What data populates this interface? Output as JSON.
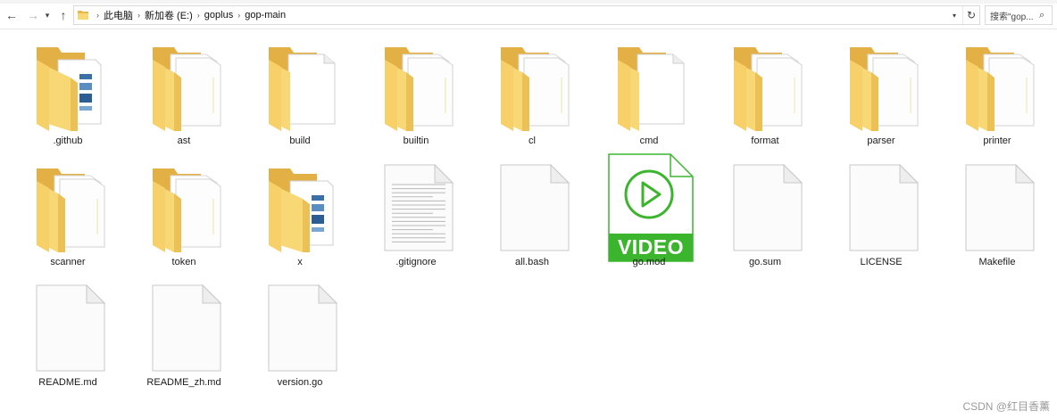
{
  "navigation": {
    "back_icon": "←",
    "forward_icon": "→",
    "recent_icon": "▾",
    "up_icon": "↑"
  },
  "address": {
    "crumbs": [
      "此电脑",
      "新加卷 (E:)",
      "goplus",
      "gop-main"
    ],
    "separator": "›",
    "dropdown_icon": "▾",
    "refresh_icon": "↻"
  },
  "search": {
    "placeholder": "搜索\"gop...",
    "icon": "⌕"
  },
  "items": [
    {
      "name": ".github",
      "kind": "folder-media"
    },
    {
      "name": "ast",
      "kind": "folder-docs"
    },
    {
      "name": "build",
      "kind": "folder-single"
    },
    {
      "name": "builtin",
      "kind": "folder-docs"
    },
    {
      "name": "cl",
      "kind": "folder-docs"
    },
    {
      "name": "cmd",
      "kind": "folder-single"
    },
    {
      "name": "format",
      "kind": "folder-docs"
    },
    {
      "name": "parser",
      "kind": "folder-docs"
    },
    {
      "name": "printer",
      "kind": "folder-docs"
    },
    {
      "name": "scanner",
      "kind": "folder-docs"
    },
    {
      "name": "token",
      "kind": "folder-docs"
    },
    {
      "name": "x",
      "kind": "folder-media"
    },
    {
      "name": ".gitignore",
      "kind": "text-file"
    },
    {
      "name": "all.bash",
      "kind": "blank-file"
    },
    {
      "name": "go.mod",
      "kind": "video-file"
    },
    {
      "name": "go.sum",
      "kind": "blank-file"
    },
    {
      "name": "LICENSE",
      "kind": "blank-file"
    },
    {
      "name": "Makefile",
      "kind": "blank-file"
    },
    {
      "name": "README.md",
      "kind": "blank-file"
    },
    {
      "name": "README_zh.md",
      "kind": "blank-file"
    },
    {
      "name": "version.go",
      "kind": "blank-file"
    }
  ],
  "video_badge": "VIDEO",
  "watermark": "CSDN @红目香薰",
  "colors": {
    "folder_back": "#E8B84A",
    "folder_front": "#F8D775",
    "video_green": "#3CB52E",
    "page_border": "#C8C8C8"
  }
}
